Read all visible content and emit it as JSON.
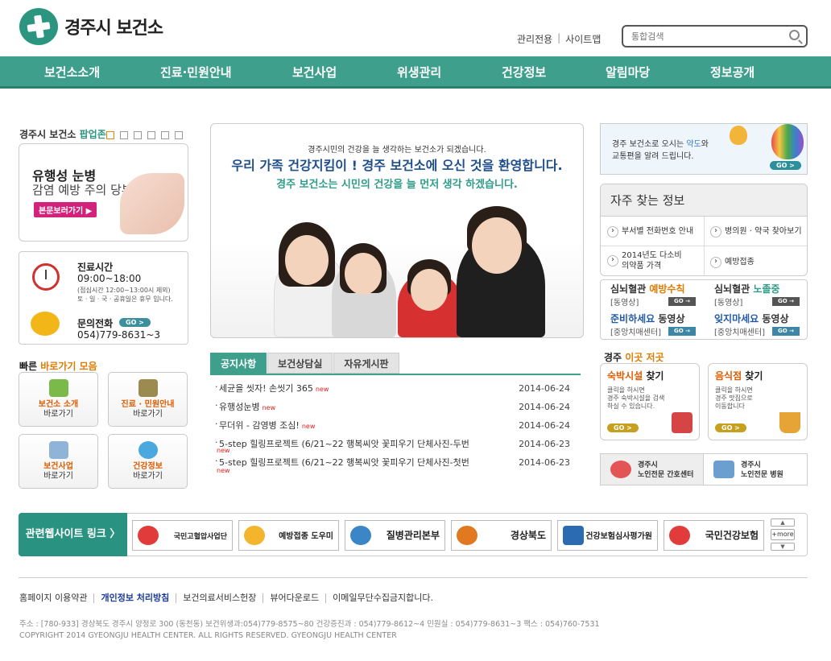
{
  "header": {
    "logo_text": "경주시 보건소",
    "util_links": [
      "관리전용",
      "사이트맵"
    ],
    "search_placeholder": "통합검색"
  },
  "nav": [
    "보건소소개",
    "진료·민원안내",
    "보건사업",
    "위생관리",
    "건강정보",
    "알림마당",
    "정보공개"
  ],
  "popup": {
    "title_prefix": "경주시 보건소 ",
    "title_highlight": "팝업존",
    "headline1": "유행성 눈병",
    "headline2": "감염 예방 주의 당부",
    "button": "본문보러가기 ▶"
  },
  "hours": {
    "title": "진료시간",
    "time": "09:00~18:00",
    "note1": "(점심시간 12:00~13:00시 제외)",
    "note2": "토 · 일 · 국 · 공휴일은 휴무 입니다.",
    "contact_title": "문의전화",
    "contact_go": "GO >",
    "phone": "054)779-8631~3"
  },
  "quick": {
    "title_prefix": "빠른 ",
    "title_highlight": "바로가기 모음",
    "items": [
      {
        "l1": "보건소 소개",
        "l2": "바로가기"
      },
      {
        "l1": "진료 · 민원안내",
        "l2": "바로가기"
      },
      {
        "l1": "보건사업",
        "l2": "바로가기"
      },
      {
        "l1": "건강정보",
        "l2": "바로가기"
      }
    ]
  },
  "visual": {
    "line1": "경주시민의 건강을 늘 생각하는 보건소가 되겠습니다.",
    "line2": "우리 가족 건강지킴이 ! 경주 보건소에 오신 것을 환영합니다.",
    "line3": "경주 보건소는 시민의 건강을 늘 먼저 생각 하겠습니다."
  },
  "board": {
    "tabs": [
      "공지사항",
      "보건상담실",
      "자유게시판"
    ],
    "new_label": "new",
    "items": [
      {
        "title": "세균을 씻자! 손씻기 365",
        "date": "2014-06-24"
      },
      {
        "title": "유행성눈병",
        "date": "2014-06-24"
      },
      {
        "title": "무더위 - 감영병 조심!",
        "date": "2014-06-24"
      },
      {
        "title": "5-step 힐링프로젝트 (6/21~22 행복씨앗 꽃피우기 단체사진-두번",
        "date": "2014-06-23"
      },
      {
        "title": "5-step 힐링프로젝트 (6/21~22 행복씨앗 꽃피우기 단체사진-첫번",
        "date": "2014-06-23"
      }
    ]
  },
  "right_banner": {
    "text1_a": "경주 보건소로 오시는 ",
    "text1_b": "약도",
    "text1_c": "와",
    "text2": "교통편을 알려 드립니다.",
    "go": "GO >"
  },
  "faq": {
    "title": "자주 찾는 정보",
    "items": [
      "부서별 전화번호 안내",
      "병의원 · 약국 찾아보기",
      "2014년도 다소비 의약품 가격",
      "예방접종"
    ]
  },
  "videos": [
    {
      "a1": "심뇌혈관 ",
      "a2": "예방수칙",
      "b": "[동영상]",
      "go": "GO →"
    },
    {
      "a1": "심뇌혈관 ",
      "a2": "노졸중",
      "b": "[동영상]",
      "go": "GO →"
    },
    {
      "a1": "준비하세요 ",
      "a2": "동영상",
      "b": "[중앙치매센터]",
      "go": "GO →"
    },
    {
      "a1": "잊지마세요 ",
      "a2": "동영상",
      "b": "[중앙치매센터]",
      "go": "GO →"
    }
  ],
  "gyeongju": {
    "title_prefix": "경주 ",
    "title_highlight": "이곳 저곳",
    "cards": [
      {
        "h": "숙박시설",
        "s": " 찾기",
        "d1": "클릭을 하시면",
        "d2": "경주 숙박시설을 검색",
        "d3": "하실 수 있습니다.",
        "go": "GO >"
      },
      {
        "h": "음식점",
        "s": " 찾기",
        "d1": "클릭을 하시면",
        "d2": "경주 맛집으로",
        "d3": "이동합니다",
        "go": "GO >"
      }
    ]
  },
  "centers": [
    {
      "l1": "경주시",
      "l2": "노인전문 간호센터"
    },
    {
      "l1": "경주시",
      "l2": "노인전문 병원"
    }
  ],
  "related": {
    "label": "관련웹사이트 링크 〉",
    "sites": [
      "국민고혈압사업단",
      "예방접종 도우미",
      "질병관리본부",
      "경상북도",
      "건강보험심사평가원",
      "국민건강보험"
    ],
    "more": "+more",
    "up": "▲",
    "down": "▼"
  },
  "footer": {
    "menu": [
      "홈페이지 이용약관",
      "개인정보 처리방침",
      "보건의료서비스헌장",
      "뷰어다운로드",
      "이메일무단수집금지합니다."
    ],
    "address": "주소 : [780-933] 경상북도 경주시 양정로 300 (동천동) 보건위생과:054)779-8575~80 건강증진과 : 054)779-8612~4 민원실 : 054)779-8631~3 팩스 : 054)760-7531",
    "copyright": "COPYRIGHT 2014 GYEONGJU HEALTH CENTER. ALL RIGHTS RESERVED. GYEONGJU HEALTH CENTER"
  },
  "colors": {
    "brand_green": "#3f9f8d",
    "accent_orange": "#e07b00",
    "new_red": "#e2201b"
  }
}
